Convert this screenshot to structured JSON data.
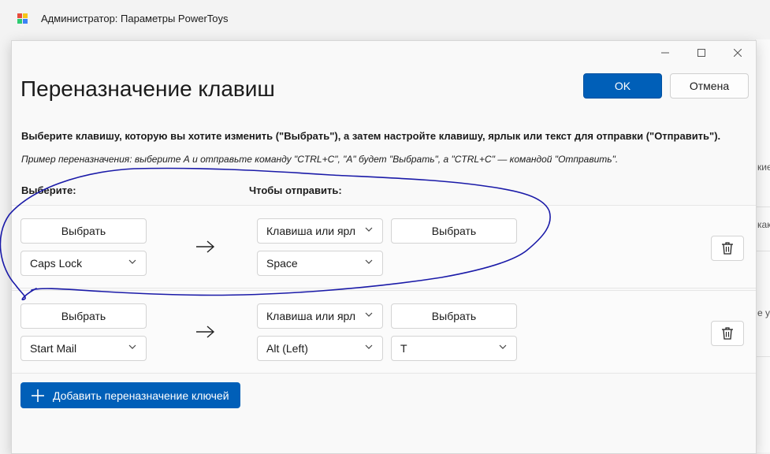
{
  "window": {
    "title": "Администратор: Параметры PowerToys",
    "app_icon": "powertoys-icon"
  },
  "background_fragments": [
    "кие",
    "как",
    "е у"
  ],
  "dialog": {
    "title": "Переназначение клавиш",
    "ok_label": "OK",
    "cancel_label": "Отмена",
    "description": "Выберите клавишу, которую вы хотите изменить (\"Выбрать\"), а затем настройте клавишу, ярлык или текст для отправки (\"Отправить\").",
    "example": "Пример переназначения: выберите А и отправьте команду \"CTRL+C\", \"A\" будет \"Выбрать\", а \"CTRL+C\" — командой \"Отправить\".",
    "col_select": "Выберите:",
    "col_send": "Чтобы отправить:",
    "add_label": "Добавить переназначение ключей",
    "caption_buttons": [
      "minimize-icon",
      "maximize-icon",
      "close-icon"
    ]
  },
  "rows": [
    {
      "select_button": "Выбрать",
      "from_key": "Caps Lock",
      "send_type": "Клавиша или ярл",
      "send_select_button": "Выбрать",
      "to_keys": [
        "Space"
      ]
    },
    {
      "select_button": "Выбрать",
      "from_key": "Start Mail",
      "send_type": "Клавиша или ярл",
      "send_select_button": "Выбрать",
      "to_keys": [
        "Alt (Left)",
        "T"
      ]
    }
  ],
  "colors": {
    "accent": "#005fb8",
    "annotation_ink": "#1a1aa8",
    "icon_red": "#e74c3c",
    "icon_yellow": "#f5c518",
    "icon_green": "#2ecc71",
    "icon_blue": "#3b82f6"
  }
}
